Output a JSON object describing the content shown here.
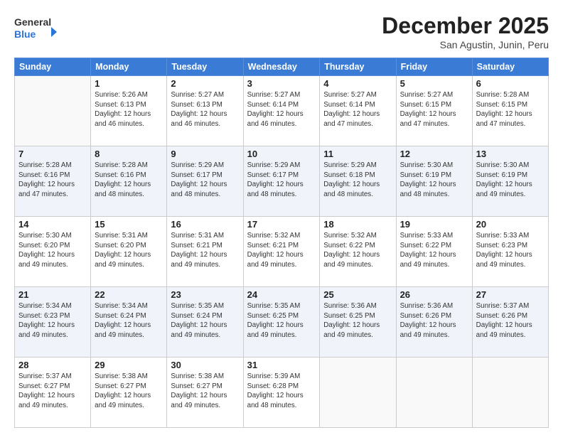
{
  "header": {
    "title": "December 2025",
    "subtitle": "San Agustin, Junin, Peru",
    "logo_general": "General",
    "logo_blue": "Blue"
  },
  "days_of_week": [
    "Sunday",
    "Monday",
    "Tuesday",
    "Wednesday",
    "Thursday",
    "Friday",
    "Saturday"
  ],
  "weeks": [
    [
      {
        "num": "",
        "info": ""
      },
      {
        "num": "1",
        "info": "Sunrise: 5:26 AM\nSunset: 6:13 PM\nDaylight: 12 hours\nand 46 minutes."
      },
      {
        "num": "2",
        "info": "Sunrise: 5:27 AM\nSunset: 6:13 PM\nDaylight: 12 hours\nand 46 minutes."
      },
      {
        "num": "3",
        "info": "Sunrise: 5:27 AM\nSunset: 6:14 PM\nDaylight: 12 hours\nand 46 minutes."
      },
      {
        "num": "4",
        "info": "Sunrise: 5:27 AM\nSunset: 6:14 PM\nDaylight: 12 hours\nand 47 minutes."
      },
      {
        "num": "5",
        "info": "Sunrise: 5:27 AM\nSunset: 6:15 PM\nDaylight: 12 hours\nand 47 minutes."
      },
      {
        "num": "6",
        "info": "Sunrise: 5:28 AM\nSunset: 6:15 PM\nDaylight: 12 hours\nand 47 minutes."
      }
    ],
    [
      {
        "num": "7",
        "info": "Sunrise: 5:28 AM\nSunset: 6:16 PM\nDaylight: 12 hours\nand 47 minutes."
      },
      {
        "num": "8",
        "info": "Sunrise: 5:28 AM\nSunset: 6:16 PM\nDaylight: 12 hours\nand 48 minutes."
      },
      {
        "num": "9",
        "info": "Sunrise: 5:29 AM\nSunset: 6:17 PM\nDaylight: 12 hours\nand 48 minutes."
      },
      {
        "num": "10",
        "info": "Sunrise: 5:29 AM\nSunset: 6:17 PM\nDaylight: 12 hours\nand 48 minutes."
      },
      {
        "num": "11",
        "info": "Sunrise: 5:29 AM\nSunset: 6:18 PM\nDaylight: 12 hours\nand 48 minutes."
      },
      {
        "num": "12",
        "info": "Sunrise: 5:30 AM\nSunset: 6:19 PM\nDaylight: 12 hours\nand 48 minutes."
      },
      {
        "num": "13",
        "info": "Sunrise: 5:30 AM\nSunset: 6:19 PM\nDaylight: 12 hours\nand 49 minutes."
      }
    ],
    [
      {
        "num": "14",
        "info": "Sunrise: 5:30 AM\nSunset: 6:20 PM\nDaylight: 12 hours\nand 49 minutes."
      },
      {
        "num": "15",
        "info": "Sunrise: 5:31 AM\nSunset: 6:20 PM\nDaylight: 12 hours\nand 49 minutes."
      },
      {
        "num": "16",
        "info": "Sunrise: 5:31 AM\nSunset: 6:21 PM\nDaylight: 12 hours\nand 49 minutes."
      },
      {
        "num": "17",
        "info": "Sunrise: 5:32 AM\nSunset: 6:21 PM\nDaylight: 12 hours\nand 49 minutes."
      },
      {
        "num": "18",
        "info": "Sunrise: 5:32 AM\nSunset: 6:22 PM\nDaylight: 12 hours\nand 49 minutes."
      },
      {
        "num": "19",
        "info": "Sunrise: 5:33 AM\nSunset: 6:22 PM\nDaylight: 12 hours\nand 49 minutes."
      },
      {
        "num": "20",
        "info": "Sunrise: 5:33 AM\nSunset: 6:23 PM\nDaylight: 12 hours\nand 49 minutes."
      }
    ],
    [
      {
        "num": "21",
        "info": "Sunrise: 5:34 AM\nSunset: 6:23 PM\nDaylight: 12 hours\nand 49 minutes."
      },
      {
        "num": "22",
        "info": "Sunrise: 5:34 AM\nSunset: 6:24 PM\nDaylight: 12 hours\nand 49 minutes."
      },
      {
        "num": "23",
        "info": "Sunrise: 5:35 AM\nSunset: 6:24 PM\nDaylight: 12 hours\nand 49 minutes."
      },
      {
        "num": "24",
        "info": "Sunrise: 5:35 AM\nSunset: 6:25 PM\nDaylight: 12 hours\nand 49 minutes."
      },
      {
        "num": "25",
        "info": "Sunrise: 5:36 AM\nSunset: 6:25 PM\nDaylight: 12 hours\nand 49 minutes."
      },
      {
        "num": "26",
        "info": "Sunrise: 5:36 AM\nSunset: 6:26 PM\nDaylight: 12 hours\nand 49 minutes."
      },
      {
        "num": "27",
        "info": "Sunrise: 5:37 AM\nSunset: 6:26 PM\nDaylight: 12 hours\nand 49 minutes."
      }
    ],
    [
      {
        "num": "28",
        "info": "Sunrise: 5:37 AM\nSunset: 6:27 PM\nDaylight: 12 hours\nand 49 minutes."
      },
      {
        "num": "29",
        "info": "Sunrise: 5:38 AM\nSunset: 6:27 PM\nDaylight: 12 hours\nand 49 minutes."
      },
      {
        "num": "30",
        "info": "Sunrise: 5:38 AM\nSunset: 6:27 PM\nDaylight: 12 hours\nand 49 minutes."
      },
      {
        "num": "31",
        "info": "Sunrise: 5:39 AM\nSunset: 6:28 PM\nDaylight: 12 hours\nand 48 minutes."
      },
      {
        "num": "",
        "info": ""
      },
      {
        "num": "",
        "info": ""
      },
      {
        "num": "",
        "info": ""
      }
    ]
  ]
}
